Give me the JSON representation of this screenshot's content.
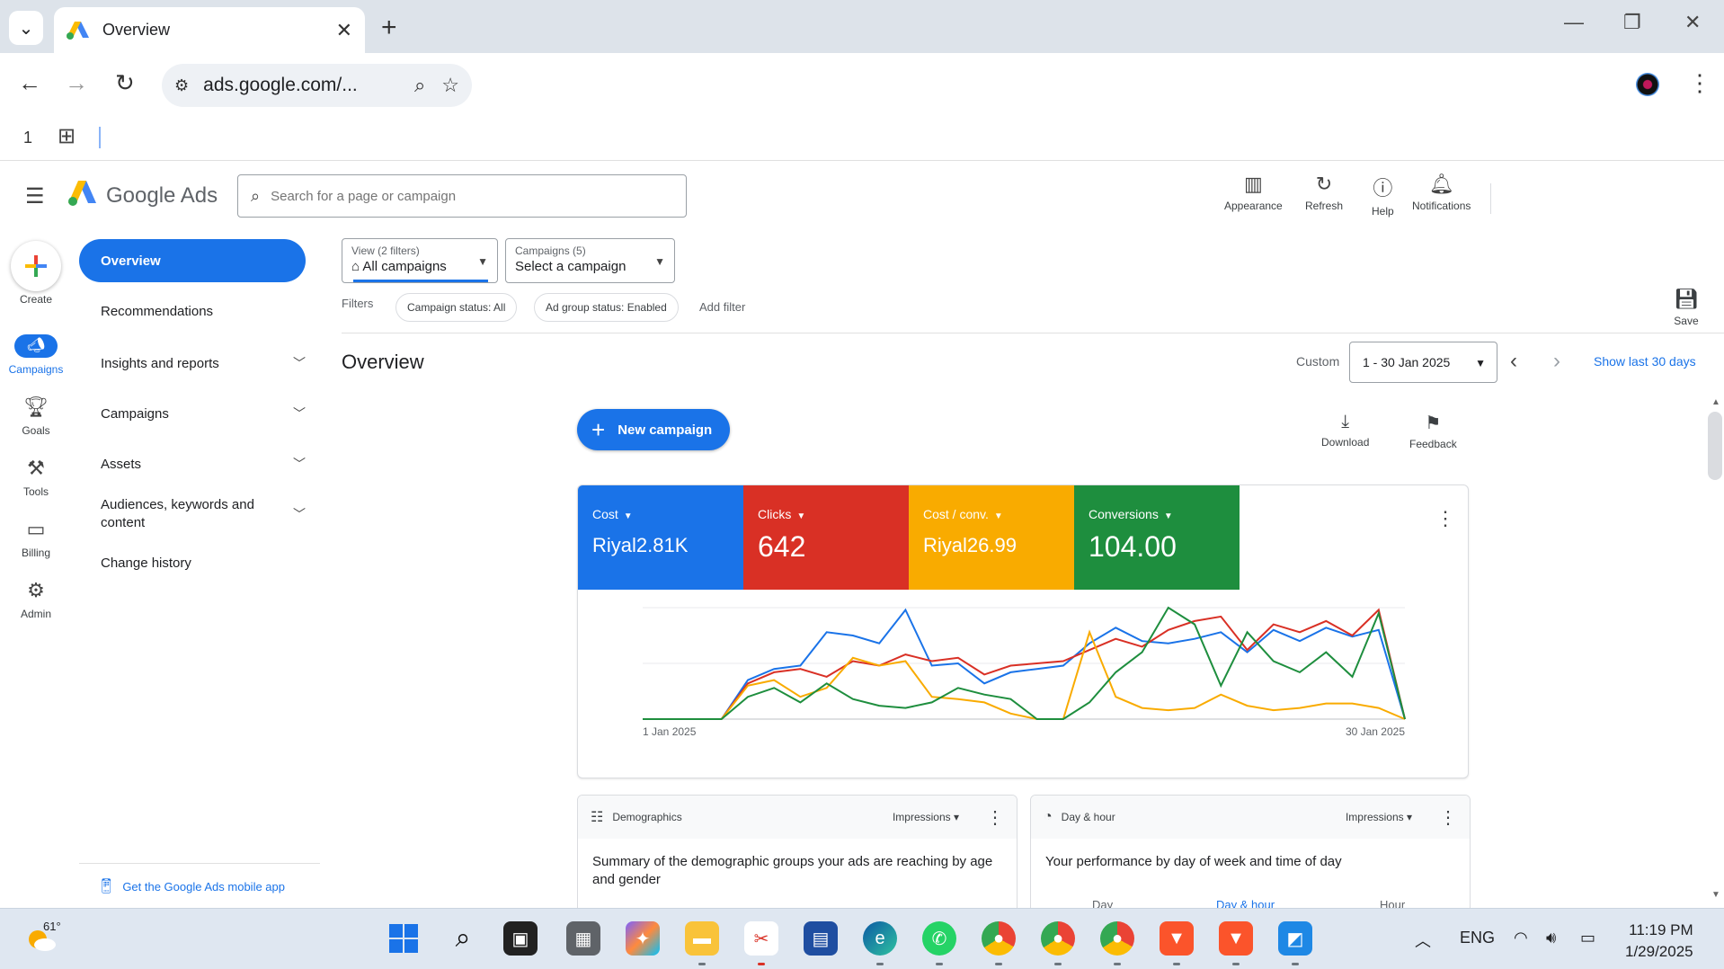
{
  "browser": {
    "tab_title": "Overview",
    "url": "ads.google.com/...",
    "tab_count": "1"
  },
  "header": {
    "brand": "Google Ads",
    "search_placeholder": "Search for a page or campaign",
    "actions": [
      {
        "label": "Appearance",
        "icon": "appearance-icon"
      },
      {
        "label": "Refresh",
        "icon": "refresh-icon"
      },
      {
        "label": "Help",
        "icon": "help-icon"
      },
      {
        "label": "Notifications",
        "icon": "bell-icon"
      }
    ]
  },
  "rail": {
    "create": "Create",
    "items": [
      {
        "label": "Campaigns",
        "icon": "megaphone-icon",
        "active": true
      },
      {
        "label": "Goals",
        "icon": "trophy-icon"
      },
      {
        "label": "Tools",
        "icon": "tools-icon"
      },
      {
        "label": "Billing",
        "icon": "billing-icon"
      },
      {
        "label": "Admin",
        "icon": "gear-icon"
      }
    ]
  },
  "sidenav": {
    "active": "Overview",
    "items": [
      {
        "label": "Recommendations"
      },
      {
        "label": "Insights and reports"
      },
      {
        "label": "Campaigns"
      },
      {
        "label": "Assets"
      },
      {
        "label": "Audiences, keywords and content"
      },
      {
        "label": "Change history"
      }
    ],
    "mobile_app": "Get the Google Ads mobile app"
  },
  "filters": {
    "view_small": "View (2 filters)",
    "view_big": "All campaigns",
    "campaigns_small": "Campaigns (5)",
    "campaigns_big": "Select a campaign",
    "label": "Filters",
    "chips": [
      "Campaign status: All",
      "Ad group status: Enabled"
    ],
    "add_filter": "Add filter",
    "save": "Save"
  },
  "overview": {
    "title": "Overview",
    "custom": "Custom",
    "date_range": "1 - 30 Jan 2025",
    "show_last": "Show last 30 days",
    "new_campaign": "New campaign",
    "download": "Download",
    "feedback": "Feedback"
  },
  "metrics": [
    {
      "label": "Cost",
      "value": "Riyal2.81K",
      "color": "#1a73e8"
    },
    {
      "label": "Clicks",
      "value": "642",
      "color": "#d93025"
    },
    {
      "label": "Cost / conv.",
      "value": "Riyal26.99",
      "color": "#f9ab00"
    },
    {
      "label": "Conversions",
      "value": "104.00",
      "color": "#1e8e3e"
    }
  ],
  "chart_data": {
    "type": "line",
    "x_start_label": "1 Jan 2025",
    "x_end_label": "30 Jan 2025",
    "ylim": [
      0,
      100
    ],
    "series": [
      {
        "name": "Cost",
        "color": "#1a73e8",
        "values": [
          0,
          0,
          0,
          0,
          35,
          45,
          48,
          78,
          75,
          68,
          98,
          48,
          50,
          32,
          42,
          45,
          48,
          68,
          82,
          70,
          68,
          72,
          78,
          60,
          80,
          70,
          82,
          74,
          80,
          0
        ]
      },
      {
        "name": "Clicks",
        "color": "#d93025",
        "values": [
          0,
          0,
          0,
          0,
          32,
          42,
          45,
          38,
          52,
          48,
          58,
          52,
          55,
          40,
          48,
          50,
          52,
          62,
          72,
          65,
          80,
          88,
          92,
          62,
          85,
          78,
          88,
          75,
          98,
          0
        ]
      },
      {
        "name": "Cost / conv.",
        "color": "#f9ab00",
        "values": [
          0,
          0,
          0,
          0,
          30,
          35,
          20,
          28,
          55,
          48,
          52,
          20,
          18,
          15,
          5,
          0,
          0,
          78,
          20,
          10,
          8,
          10,
          22,
          12,
          8,
          10,
          14,
          14,
          10,
          0
        ]
      },
      {
        "name": "Conversions",
        "color": "#1e8e3e",
        "values": [
          0,
          0,
          0,
          0,
          20,
          28,
          15,
          32,
          18,
          12,
          10,
          15,
          28,
          22,
          18,
          0,
          0,
          15,
          42,
          60,
          100,
          85,
          30,
          78,
          52,
          42,
          60,
          38,
          95,
          0
        ]
      }
    ]
  },
  "cards": {
    "demographics": {
      "title": "Demographics",
      "metric": "Impressions",
      "desc": "Summary of the demographic groups your ads are reaching by age and gender"
    },
    "dayhour": {
      "title": "Day & hour",
      "metric": "Impressions",
      "desc": "Your performance by day of week and time of day",
      "tabs": [
        "Day",
        "Day & hour",
        "Hour"
      ]
    }
  },
  "taskbar": {
    "temperature": "61°",
    "language": "ENG",
    "time": "11:19 PM",
    "date": "1/29/2025"
  }
}
